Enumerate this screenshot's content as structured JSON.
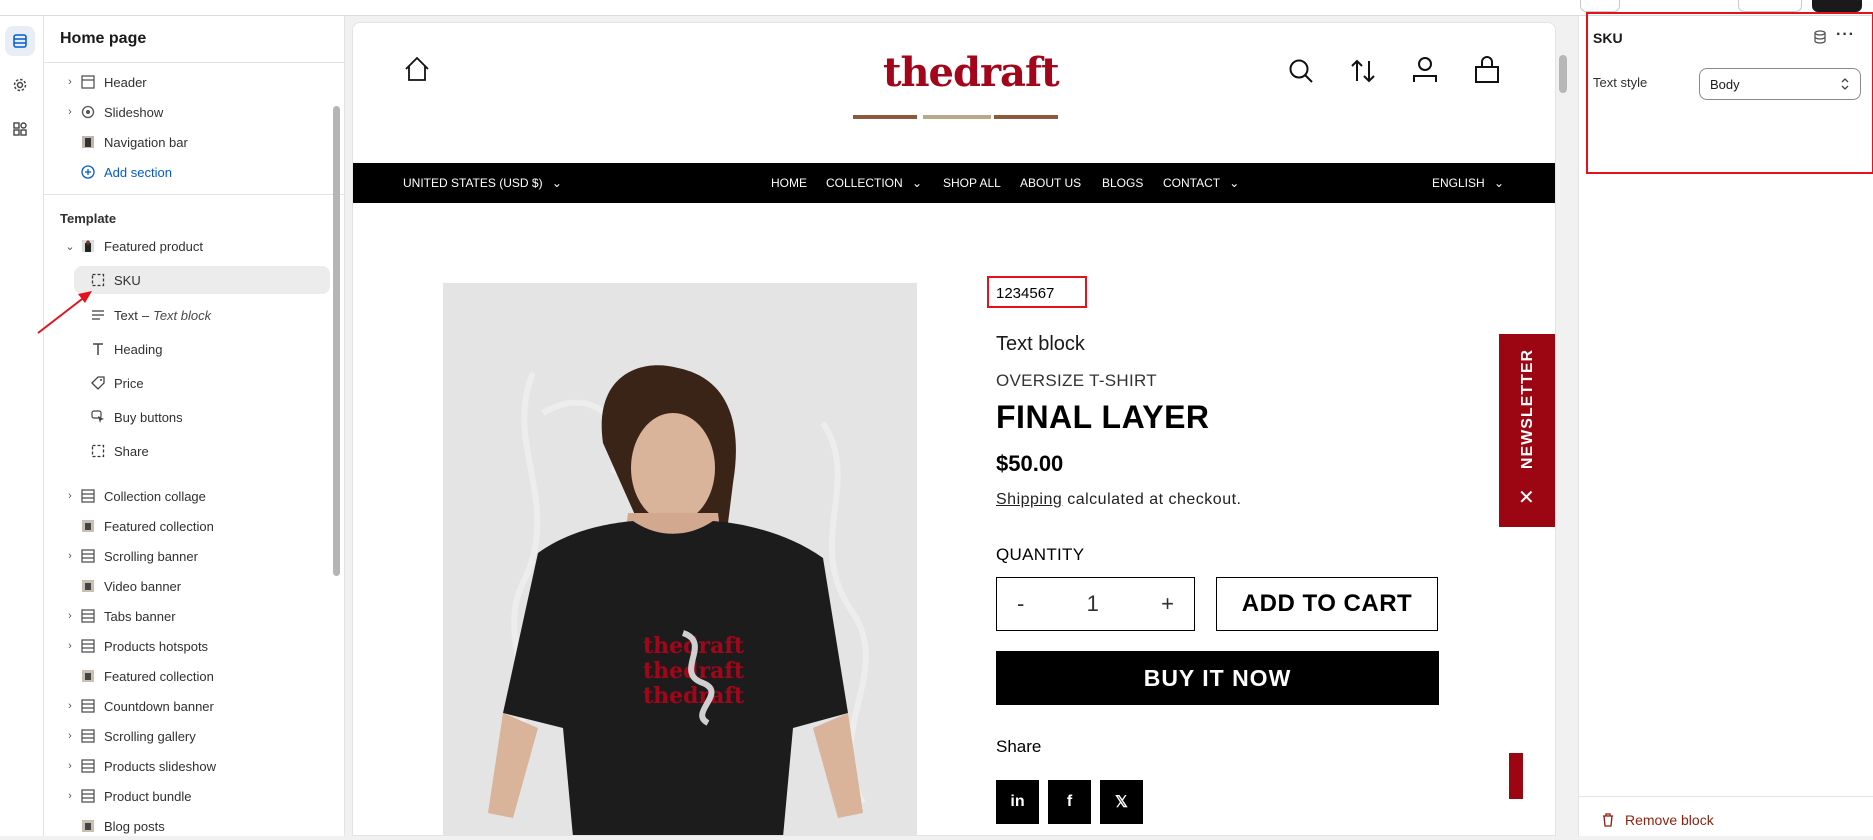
{
  "sidebar": {
    "title": "Home page",
    "sections": [
      {
        "label": "Header",
        "expandable": true,
        "icon": "layout-icon"
      },
      {
        "label": "Slideshow",
        "expandable": true,
        "icon": "slideshow-icon"
      },
      {
        "label": "Navigation bar",
        "expandable": false,
        "icon": "image-thumb-icon"
      }
    ],
    "add_section": "Add section",
    "template_heading": "Template",
    "featured_product": "Featured product",
    "blocks": [
      {
        "label": "SKU",
        "icon": "sku-block-icon",
        "suffix": ""
      },
      {
        "label": "Text",
        "icon": "text-lines-icon",
        "suffix": "Text block"
      },
      {
        "label": "Heading",
        "icon": "heading-icon",
        "suffix": ""
      },
      {
        "label": "Price",
        "icon": "price-tag-icon",
        "suffix": ""
      },
      {
        "label": "Buy buttons",
        "icon": "cursor-icon",
        "suffix": ""
      },
      {
        "label": "Share",
        "icon": "share-block-icon",
        "suffix": ""
      }
    ],
    "text_dash": "–",
    "more_sections": [
      {
        "label": "Collection collage",
        "expandable": true
      },
      {
        "label": "Featured collection",
        "expandable": false
      },
      {
        "label": "Scrolling banner",
        "expandable": true
      },
      {
        "label": "Video banner",
        "expandable": false
      },
      {
        "label": "Tabs banner",
        "expandable": true
      },
      {
        "label": "Products hotspots",
        "expandable": true
      },
      {
        "label": "Featured collection",
        "expandable": false
      },
      {
        "label": "Countdown banner",
        "expandable": true
      },
      {
        "label": "Scrolling gallery",
        "expandable": true
      },
      {
        "label": "Products slideshow",
        "expandable": true
      },
      {
        "label": "Product bundle",
        "expandable": true
      },
      {
        "label": "Blog posts",
        "expandable": false
      }
    ]
  },
  "preview": {
    "logo": "thedraft",
    "nav": {
      "currency": "UNITED STATES (USD $)",
      "links": [
        "HOME",
        "COLLECTION",
        "SHOP ALL",
        "ABOUT US",
        "BLOGS",
        "CONTACT"
      ],
      "language": "ENGLISH"
    },
    "product": {
      "sku": "1234567",
      "text_block": "Text block",
      "subtitle": "OVERSIZE T-SHIRT",
      "title": "FINAL LAYER",
      "price": "$50.00",
      "shipping_link": "Shipping",
      "shipping_rest": " calculated at checkout.",
      "quantity_label": "QUANTITY",
      "qty_minus": "-",
      "qty_value": "1",
      "qty_plus": "+",
      "add_to_cart": "ADD TO CART",
      "buy_now": "BUY IT NOW",
      "share_label": "Share",
      "social": [
        "in",
        "f",
        "𝕏"
      ],
      "shirt_print": "thedraft"
    },
    "newsletter": "NEWSLETTER",
    "close": "✕"
  },
  "right_panel": {
    "title": "SKU",
    "text_style_label": "Text style",
    "text_style_value": "Body",
    "remove_block": "Remove block"
  },
  "colors": {
    "brand_red": "#a3061a",
    "annotation_red": "#e3131d",
    "link_blue": "#005bd3"
  }
}
